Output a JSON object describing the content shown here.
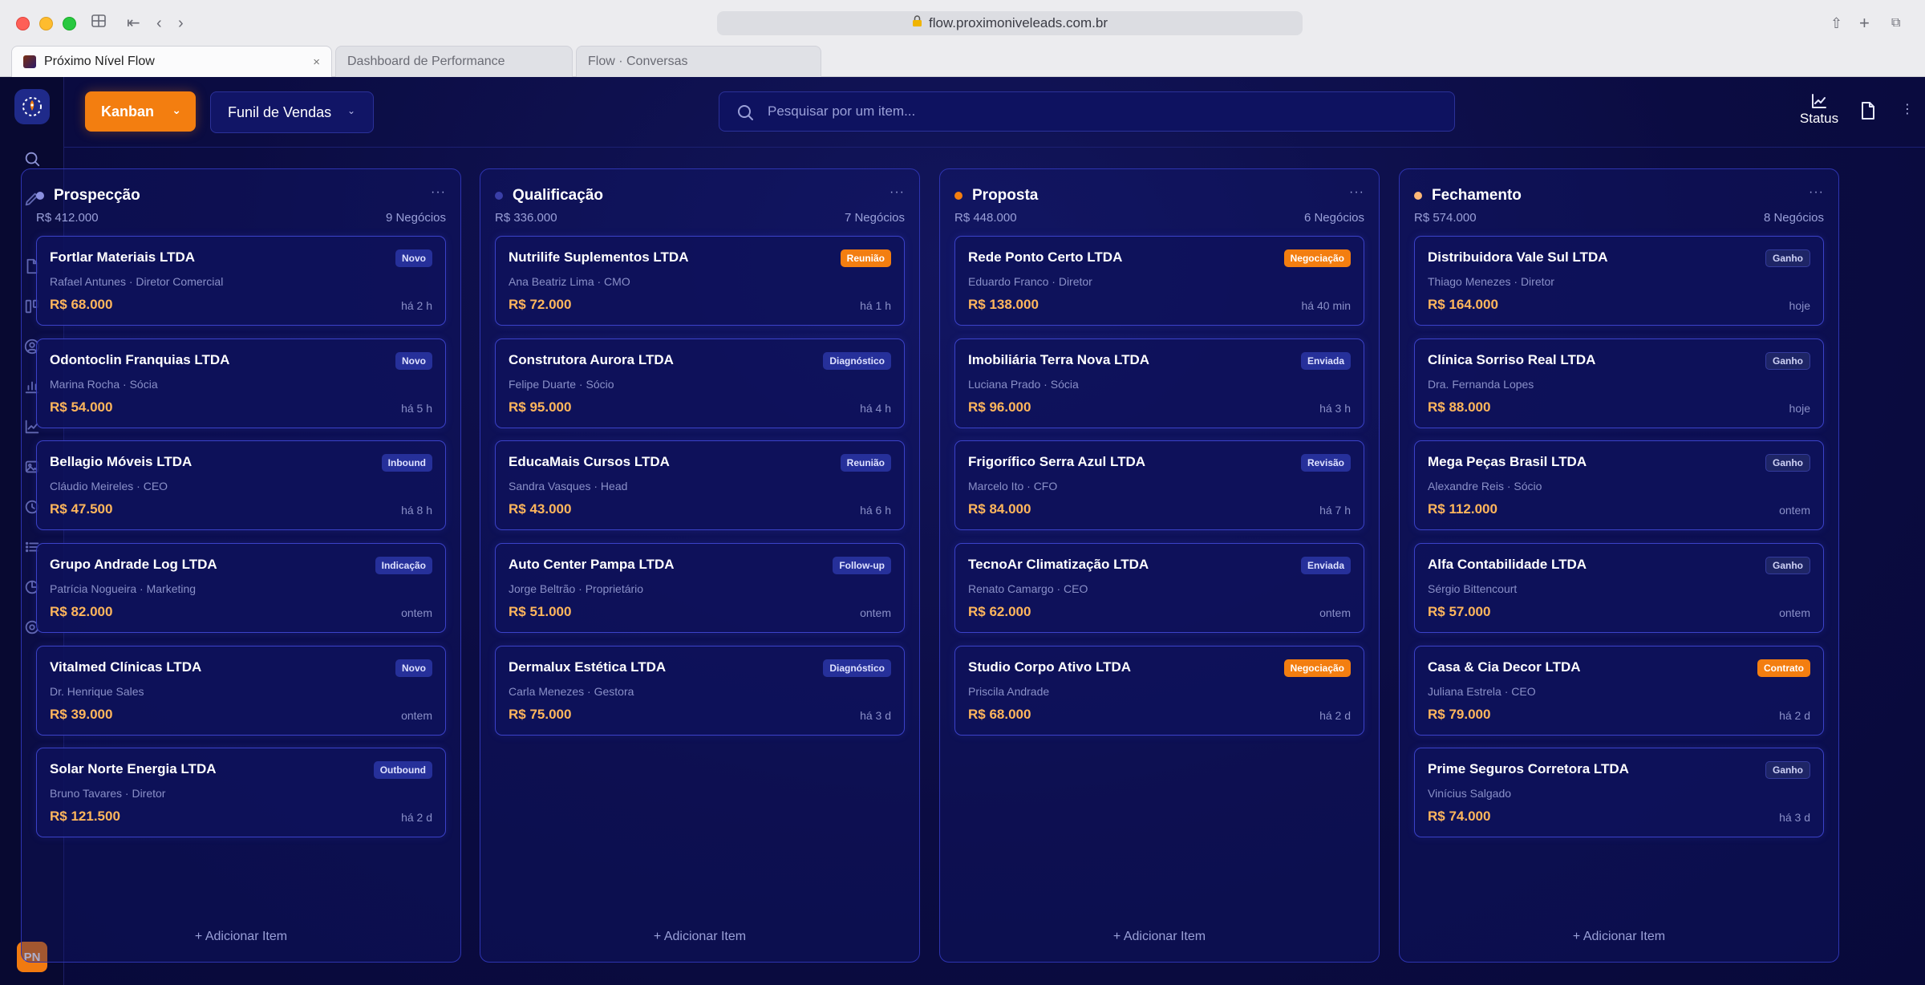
{
  "browser": {
    "url": "flow.proximoniveleads.com.br",
    "tabs": [
      {
        "label": "Próximo Nível Flow"
      },
      {
        "label": "Dashboard de Performance"
      },
      {
        "label": "Flow · Conversas"
      }
    ]
  },
  "toolbar": {
    "view_label": "Kanban",
    "funnel_label": "Funil de Vendas",
    "search_placeholder": "Pesquisar por um item...",
    "status_label": "Status"
  },
  "user": {
    "initials": "PN"
  },
  "add_item_label": "+ Adicionar Item",
  "columns": [
    {
      "title": "Prospecção",
      "total": "R$ 412.000",
      "count": "9 Negócios",
      "dot_color": "#8a8fe0",
      "cards": [
        {
          "company": "Fortlar Materiais LTDA",
          "contact": "Rafael Antunes · Diretor Comercial",
          "value": "R$ 68.000",
          "time": "há 2 h",
          "badge": "Novo",
          "badge_style": "blue"
        },
        {
          "company": "Odontoclin Franquias LTDA",
          "contact": "Marina Rocha · Sócia",
          "value": "R$ 54.000",
          "time": "há 5 h",
          "badge": "Novo",
          "badge_style": "blue"
        },
        {
          "company": "Bellagio Móveis LTDA",
          "contact": "Cláudio Meireles · CEO",
          "value": "R$ 47.500",
          "time": "há 8 h",
          "badge": "Inbound",
          "badge_style": "blue"
        },
        {
          "company": "Grupo Andrade Log LTDA",
          "contact": "Patrícia Nogueira · Marketing",
          "value": "R$ 82.000",
          "time": "ontem",
          "badge": "Indicação",
          "badge_style": "blue"
        },
        {
          "company": "Vitalmed Clínicas LTDA",
          "contact": "Dr. Henrique Sales",
          "value": "R$ 39.000",
          "time": "ontem",
          "badge": "Novo",
          "badge_style": "blue"
        },
        {
          "company": "Solar Norte Energia LTDA",
          "contact": "Bruno Tavares · Diretor",
          "value": "R$ 121.500",
          "time": "há 2 d",
          "badge": "Outbound",
          "badge_style": "blue"
        }
      ]
    },
    {
      "title": "Qualificação",
      "total": "R$ 336.000",
      "count": "7 Negócios",
      "dot_color": "#3a3fa8",
      "cards": [
        {
          "company": "Nutrilife Suplementos LTDA",
          "contact": "Ana Beatriz Lima · CMO",
          "value": "R$ 72.000",
          "time": "há 1 h",
          "badge": "Reunião",
          "badge_style": "orange"
        },
        {
          "company": "Construtora Aurora LTDA",
          "contact": "Felipe Duarte · Sócio",
          "value": "R$ 95.000",
          "time": "há 4 h",
          "badge": "Diagnóstico",
          "badge_style": "blue"
        },
        {
          "company": "EducaMais Cursos LTDA",
          "contact": "Sandra Vasques · Head",
          "value": "R$ 43.000",
          "time": "há 6 h",
          "badge": "Reunião",
          "badge_style": "blue"
        },
        {
          "company": "Auto Center Pampa LTDA",
          "contact": "Jorge Beltrão · Proprietário",
          "value": "R$ 51.000",
          "time": "ontem",
          "badge": "Follow-up",
          "badge_style": "blue"
        },
        {
          "company": "Dermalux Estética LTDA",
          "contact": "Carla Menezes · Gestora",
          "value": "R$ 75.000",
          "time": "há 3 d",
          "badge": "Diagnóstico",
          "badge_style": "blue"
        }
      ]
    },
    {
      "title": "Proposta",
      "total": "R$ 448.000",
      "count": "6 Negócios",
      "dot_color": "#f37e10",
      "cards": [
        {
          "company": "Rede Ponto Certo LTDA",
          "contact": "Eduardo Franco · Diretor",
          "value": "R$ 138.000",
          "time": "há 40 min",
          "badge": "Negociação",
          "badge_style": "orange"
        },
        {
          "company": "Imobiliária Terra Nova LTDA",
          "contact": "Luciana Prado · Sócia",
          "value": "R$ 96.000",
          "time": "há 3 h",
          "badge": "Enviada",
          "badge_style": "blue"
        },
        {
          "company": "Frigorífico Serra Azul LTDA",
          "contact": "Marcelo Ito · CFO",
          "value": "R$ 84.000",
          "time": "há 7 h",
          "badge": "Revisão",
          "badge_style": "blue"
        },
        {
          "company": "TecnoAr Climatização LTDA",
          "contact": "Renato Camargo · CEO",
          "value": "R$ 62.000",
          "time": "ontem",
          "badge": "Enviada",
          "badge_style": "blue"
        },
        {
          "company": "Studio Corpo Ativo LTDA",
          "contact": "Priscila Andrade",
          "value": "R$ 68.000",
          "time": "há 2 d",
          "badge": "Negociação",
          "badge_style": "orange"
        }
      ]
    },
    {
      "title": "Fechamento",
      "total": "R$ 574.000",
      "count": "8 Negócios",
      "dot_color": "#ffb877",
      "cards": [
        {
          "company": "Distribuidora Vale Sul LTDA",
          "contact": "Thiago Menezes · Diretor",
          "value": "R$ 164.000",
          "time": "hoje",
          "badge": "Ganho",
          "badge_style": "green"
        },
        {
          "company": "Clínica Sorriso Real LTDA",
          "contact": "Dra. Fernanda Lopes",
          "value": "R$ 88.000",
          "time": "hoje",
          "badge": "Ganho",
          "badge_style": "green"
        },
        {
          "company": "Mega Peças Brasil LTDA",
          "contact": "Alexandre Reis · Sócio",
          "value": "R$ 112.000",
          "time": "ontem",
          "badge": "Ganho",
          "badge_style": "green"
        },
        {
          "company": "Alfa Contabilidade LTDA",
          "contact": "Sérgio Bittencourt",
          "value": "R$ 57.000",
          "time": "ontem",
          "badge": "Ganho",
          "badge_style": "green"
        },
        {
          "company": "Casa & Cia Decor LTDA",
          "contact": "Juliana Estrela · CEO",
          "value": "R$ 79.000",
          "time": "há 2 d",
          "badge": "Contrato",
          "badge_style": "orange"
        },
        {
          "company": "Prime Seguros Corretora LTDA",
          "contact": "Vinícius Salgado",
          "value": "R$ 74.000",
          "time": "há 3 d",
          "badge": "Ganho",
          "badge_style": "green"
        }
      ]
    }
  ]
}
